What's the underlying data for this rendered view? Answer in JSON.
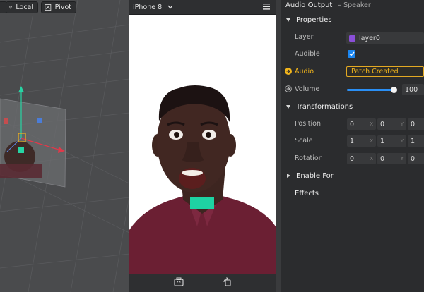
{
  "viewport": {
    "local_label": "Local",
    "pivot_label": "Pivot"
  },
  "simulator": {
    "device": "iPhone 8"
  },
  "inspector": {
    "title": "Audio Output",
    "subtitle": "– Speaker",
    "properties_label": "Properties",
    "layer": {
      "label": "Layer",
      "value": "layer0",
      "swatch_color": "#8a4fd8"
    },
    "audible": {
      "label": "Audible",
      "checked": true
    },
    "audio": {
      "label": "Audio",
      "value": "Patch Created"
    },
    "volume": {
      "label": "Volume",
      "value": "100",
      "level": 1.0
    },
    "transformations_label": "Transformations",
    "position": {
      "label": "Position",
      "x": "0",
      "y": "0",
      "z": "0"
    },
    "scale": {
      "label": "Scale",
      "x": "1",
      "y": "1",
      "z": "1"
    },
    "rotation": {
      "label": "Rotation",
      "x": "0",
      "y": "0",
      "z": "0"
    },
    "enable_for_label": "Enable For",
    "effects_label": "Effects",
    "axis": {
      "x": "X",
      "y": "Y"
    }
  },
  "colors": {
    "accent_blue": "#2a8ff5",
    "patch_yellow": "#f2b51c",
    "audio_marker": "#1ed3a3"
  }
}
